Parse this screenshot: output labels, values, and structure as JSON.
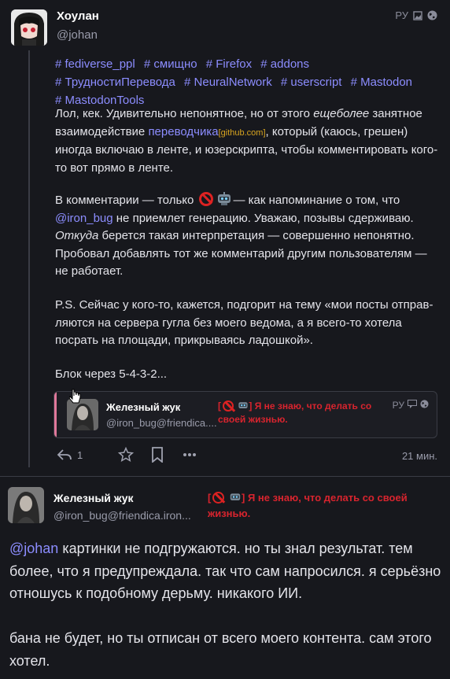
{
  "post": {
    "author_name": "Хоулан",
    "author_handle": "@johan",
    "language": "РУ",
    "tags": [
      "# fediverse_ppl",
      "# смищно",
      "# Firefox",
      "# addons",
      "# ТрудностиПеревода",
      "# NeuralNetwork",
      "# userscript",
      "# Mastodon",
      "# MastodonTools"
    ],
    "p1": {
      "a": "Лол, кек. Удивительно непонятное, но от этого ",
      "em": "ещеболее",
      "b": " занятное взаимодействие ",
      "link": "переводчика",
      "small_link": "[github.com]",
      "c": ", который (каюсь, грешен) иногда включаю в ленте, и юзерскрипта, чтобы комментировать кого-то вот прямо в ленте."
    },
    "p2": {
      "a": "В комментарии — только ",
      "b": "— как напоминание о том, что ",
      "mention": "@iron_bug",
      "c": " не приемлет генерацию. Уважаю, позывы сдерживаю. ",
      "em": "Откуда",
      "d": " берется такая интерпретация — совершенно непонятно. Пробовал добавлять тот же комментарий другим пользователям — не работает."
    },
    "p3": "P.S. Сейчас у кого-то, кажется, подгорит на тему «мои посты отправ­ляются на сервера гугла без моего ведома, а я всего-то хотела посрать на площади, прикрываясь ладошкой».",
    "p4": "Блок через 5-4-3-2...",
    "quote": {
      "name": "Железный жук",
      "handle": "@iron_bug@friendica....",
      "bio_text": "Я не знаю, что делать со своей жизнью.",
      "language": "РУ"
    },
    "actions": {
      "reply_count": "1"
    },
    "time": "21 мин."
  },
  "reply": {
    "name": "Железный жук",
    "handle": "@iron_bug@friendica.iron...",
    "bio_text": "Я не знаю, что делать со своей жизнью.",
    "mention": "@johan",
    "line1": " картинки не подгружаются. но ты знал результат. тем более, что я предупреждала. так что сам напросился. я серьёзно отношусь к подобному дерьму. никакого ИИ.",
    "line2": "бана не будет, но ты отписан от всего моего контента. сам этого хотел."
  },
  "colors": {
    "background": "#17181d",
    "accent_link": "#8c8dff",
    "bio_red": "#d8242e",
    "quote_accent": "#e0789a"
  },
  "icons": [
    "globe-icon",
    "image-icon",
    "reply-icon",
    "star-icon",
    "bookmark-icon",
    "more-icon",
    "quote-icon",
    "no-entry-icon",
    "robot-icon"
  ]
}
